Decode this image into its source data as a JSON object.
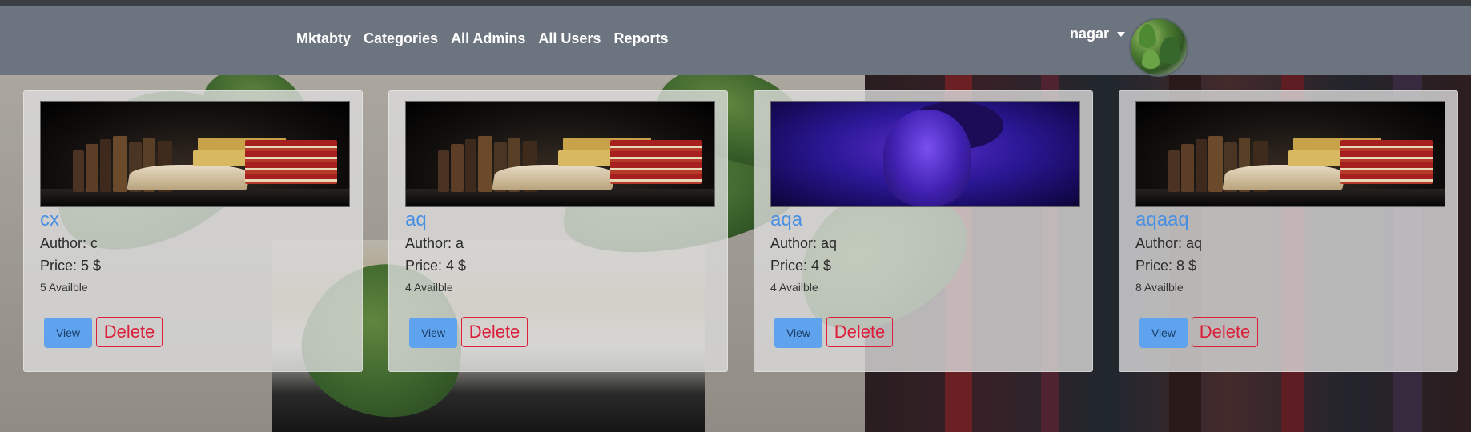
{
  "nav": {
    "links": [
      "Mktabty",
      "Categories",
      "All Admins",
      "All Users",
      "Reports"
    ]
  },
  "user": {
    "name": "nagar"
  },
  "cards": [
    {
      "title": "cx",
      "author": "Author: c",
      "price": "Price: 5 $",
      "available": "5 Availble",
      "view_label": "View",
      "delete_label": "Delete",
      "image": "books"
    },
    {
      "title": "aq",
      "author": "Author: a",
      "price": "Price: 4 $",
      "available": "4 Availble",
      "view_label": "View",
      "delete_label": "Delete",
      "image": "books"
    },
    {
      "title": "aqa",
      "author": "Author: aq",
      "price": "Price: 4 $",
      "available": "4 Availble",
      "view_label": "View",
      "delete_label": "Delete",
      "image": "purple-portrait"
    },
    {
      "title": "aqaaq",
      "author": "Author: aq",
      "price": "Price: 8 $",
      "available": "8 Availble",
      "view_label": "View",
      "delete_label": "Delete",
      "image": "books"
    }
  ],
  "colors": {
    "navbar": "#6c747f",
    "link": "#4a90e2",
    "view_button": "#5fa3ef",
    "delete": "#dc1f3a"
  }
}
